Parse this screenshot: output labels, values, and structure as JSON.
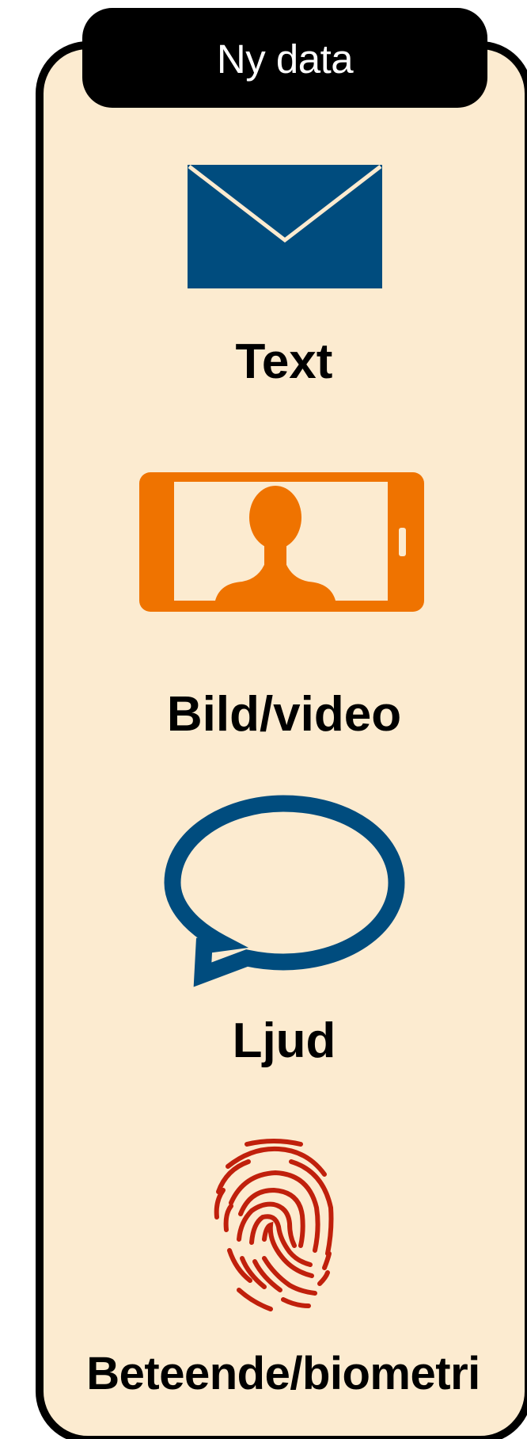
{
  "header": {
    "title": "Ny data"
  },
  "items": [
    {
      "label": "Text",
      "icon": "envelope-icon",
      "color": "#004c7e"
    },
    {
      "label": "Bild/video",
      "icon": "phone-selfie-icon",
      "color": "#ef7300"
    },
    {
      "label": "Ljud",
      "icon": "speech-bubble-icon",
      "color": "#004c7e"
    },
    {
      "label": "Beteende/biometri",
      "icon": "fingerprint-icon",
      "color": "#c0200c"
    }
  ],
  "colors": {
    "panel_background": "#fcebd0",
    "panel_border": "#000000",
    "header_background": "#000000",
    "header_text": "#ffffff"
  }
}
